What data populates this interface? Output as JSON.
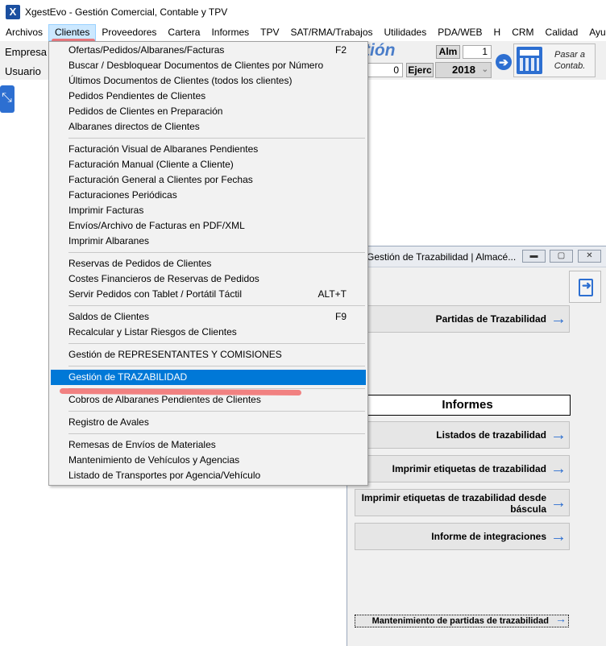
{
  "window": {
    "title": "XgestEvo - Gestión Comercial, Contable y TPV"
  },
  "menubar": [
    {
      "label": "Archivos"
    },
    {
      "label": "Clientes"
    },
    {
      "label": "Proveedores"
    },
    {
      "label": "Cartera"
    },
    {
      "label": "Informes"
    },
    {
      "label": "TPV"
    },
    {
      "label": "SAT/RMA/Trabajos"
    },
    {
      "label": "Utilidades"
    },
    {
      "label": "PDA/WEB"
    },
    {
      "label": "H"
    },
    {
      "label": "CRM"
    },
    {
      "label": "Calidad"
    },
    {
      "label": "Ayuda"
    }
  ],
  "header": {
    "empresa": "Empresa",
    "usuario": "Usuario",
    "gestion_fragment": "tión",
    "alm_label": "Alm",
    "alm_value": "1",
    "field_value": "0",
    "ejerc_label": "Ejerc",
    "year": "2018",
    "contab_button": "Pasar a Contab."
  },
  "dropdown": {
    "items": [
      {
        "label": "Ofertas/Pedidos/Albaranes/Facturas",
        "shortcut": "F2"
      },
      {
        "label": "Buscar / Desbloquear Documentos de Clientes por Número",
        "shortcut": ""
      },
      {
        "label": "Últimos Documentos de Clientes (todos los clientes)",
        "shortcut": ""
      },
      {
        "label": "Pedidos Pendientes de Clientes",
        "shortcut": ""
      },
      {
        "label": "Pedidos de Clientes en Preparación",
        "shortcut": ""
      },
      {
        "label": "Albaranes directos de Clientes",
        "shortcut": ""
      },
      {
        "label": "Facturación Visual de Albaranes Pendientes",
        "shortcut": ""
      },
      {
        "label": "Facturación Manual (Cliente a Cliente)",
        "shortcut": ""
      },
      {
        "label": "Facturación General a Clientes por Fechas",
        "shortcut": ""
      },
      {
        "label": "Facturaciones Periódicas",
        "shortcut": ""
      },
      {
        "label": "Imprimir Facturas",
        "shortcut": ""
      },
      {
        "label": "Envíos/Archivo de Facturas en PDF/XML",
        "shortcut": ""
      },
      {
        "label": "Imprimir Albaranes",
        "shortcut": ""
      },
      {
        "label": "Reservas de Pedidos de Clientes",
        "shortcut": ""
      },
      {
        "label": "Costes Financieros de Reservas de Pedidos",
        "shortcut": ""
      },
      {
        "label": "Servir Pedidos con Tablet / Portátil Táctil",
        "shortcut": "ALT+T"
      },
      {
        "label": "Saldos de Clientes",
        "shortcut": "F9"
      },
      {
        "label": "Recalcular y Listar Riesgos de Clientes",
        "shortcut": ""
      },
      {
        "label": "Gestión de REPRESENTANTES Y COMISIONES",
        "shortcut": ""
      },
      {
        "label": "Gestión de TRAZABILIDAD",
        "shortcut": ""
      },
      {
        "label": "Cobros de Albaranes Pendientes de Clientes",
        "shortcut": ""
      },
      {
        "label": "Registro de Avales",
        "shortcut": ""
      },
      {
        "label": "Remesas de Envíos de Materiales",
        "shortcut": ""
      },
      {
        "label": "Mantenimiento de Vehículos y Agencias",
        "shortcut": ""
      },
      {
        "label": "Listado de Transportes por Agencia/Vehículo",
        "shortcut": ""
      }
    ]
  },
  "traz_window": {
    "title": "Gestión de Trazabilidad   | Almacé...",
    "partidas_button": "Partidas de Trazabilidad",
    "informes_header": "Informes",
    "listados_button": "Listados de trazabilidad",
    "etiquetas_button": "Imprimir etiquetas de trazabilidad",
    "etiquetas_bascula_button": "Imprimir etiquetas de trazabilidad desde báscula",
    "integraciones_button": "Informe de integraciones",
    "mantenimiento_button": "Mantenimiento de partidas de trazabilidad"
  },
  "colors": {
    "selection": "#0078d7",
    "accent_blue": "#2d6fd1",
    "annotation_red": "#f05b5b"
  }
}
